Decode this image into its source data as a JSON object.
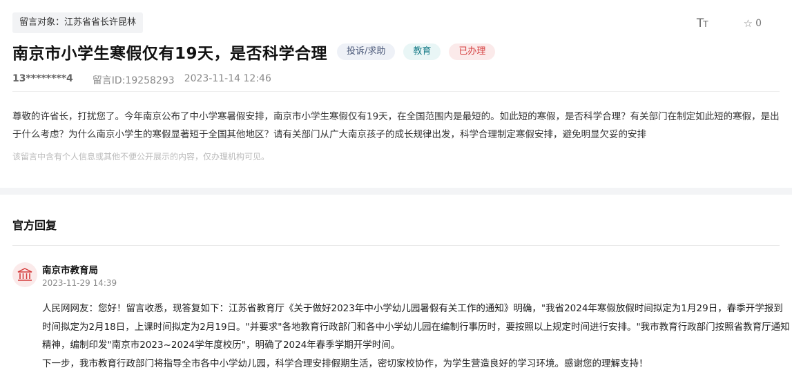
{
  "message": {
    "target": "留言对象：江苏省省长许昆林",
    "title": "南京市小学生寒假仅有19天，是否科学合理",
    "tags": {
      "type": "投诉/求助",
      "field": "教育",
      "status": "已办理"
    },
    "user": "13********4",
    "message_id": "留言ID:19258293",
    "time": "2023-11-14 12:46",
    "content": "尊敬的许省长，打扰您了。今年南京公布了中小学寒暑假安排，南京市小学生寒假仅有19天，在全国范围内是最短的。如此短的寒假，是否科学合理？有关部门在制定如此短的寒假，是出于什么考虑？为什么南京小学生的寒假显著短于全国其他地区？请有关部门从广大南京孩子的成长规律出发，科学合理制定寒假安排，避免明显欠妥的安排",
    "privacy_notice": "该留言中含有个人信息或其他不便公开展示的内容，仅办理机构可见。"
  },
  "toolbar": {
    "font_size_label": "T",
    "font_size_label_small": "T",
    "favorite_count": "0"
  },
  "reply": {
    "header": "官方回复",
    "department": "南京市教育局",
    "time": "2023-11-29 14:39",
    "paragraph1": "人民网网友：您好！留言收悉，现答复如下：江苏省教育厅《关于做好2023年中小学幼儿园暑假有关工作的通知》明确，\"我省2024年寒假放假时间拟定为1月29日，春季开学报到时间拟定为2月18日，上课时间拟定为2月19日。\"并要求\"各地教育行政部门和各中小学幼儿园在编制行事历时，要按照以上规定时间进行安排。\"我市教育行政部门按照省教育厅通知精神，编制印发\"南京市2023~2024学年度校历\"，明确了2024年春季学期开学时间。",
    "paragraph2": "下一步，我市教育行政部门将指导全市各中小学幼儿园，科学合理安排假期生活，密切家校协作，为学生营造良好的学习环境。感谢您的理解支持！"
  },
  "colors": {
    "status_red": "#d43c3c",
    "field_teal": "#1c7e8a",
    "type_slate": "#4a5878"
  }
}
